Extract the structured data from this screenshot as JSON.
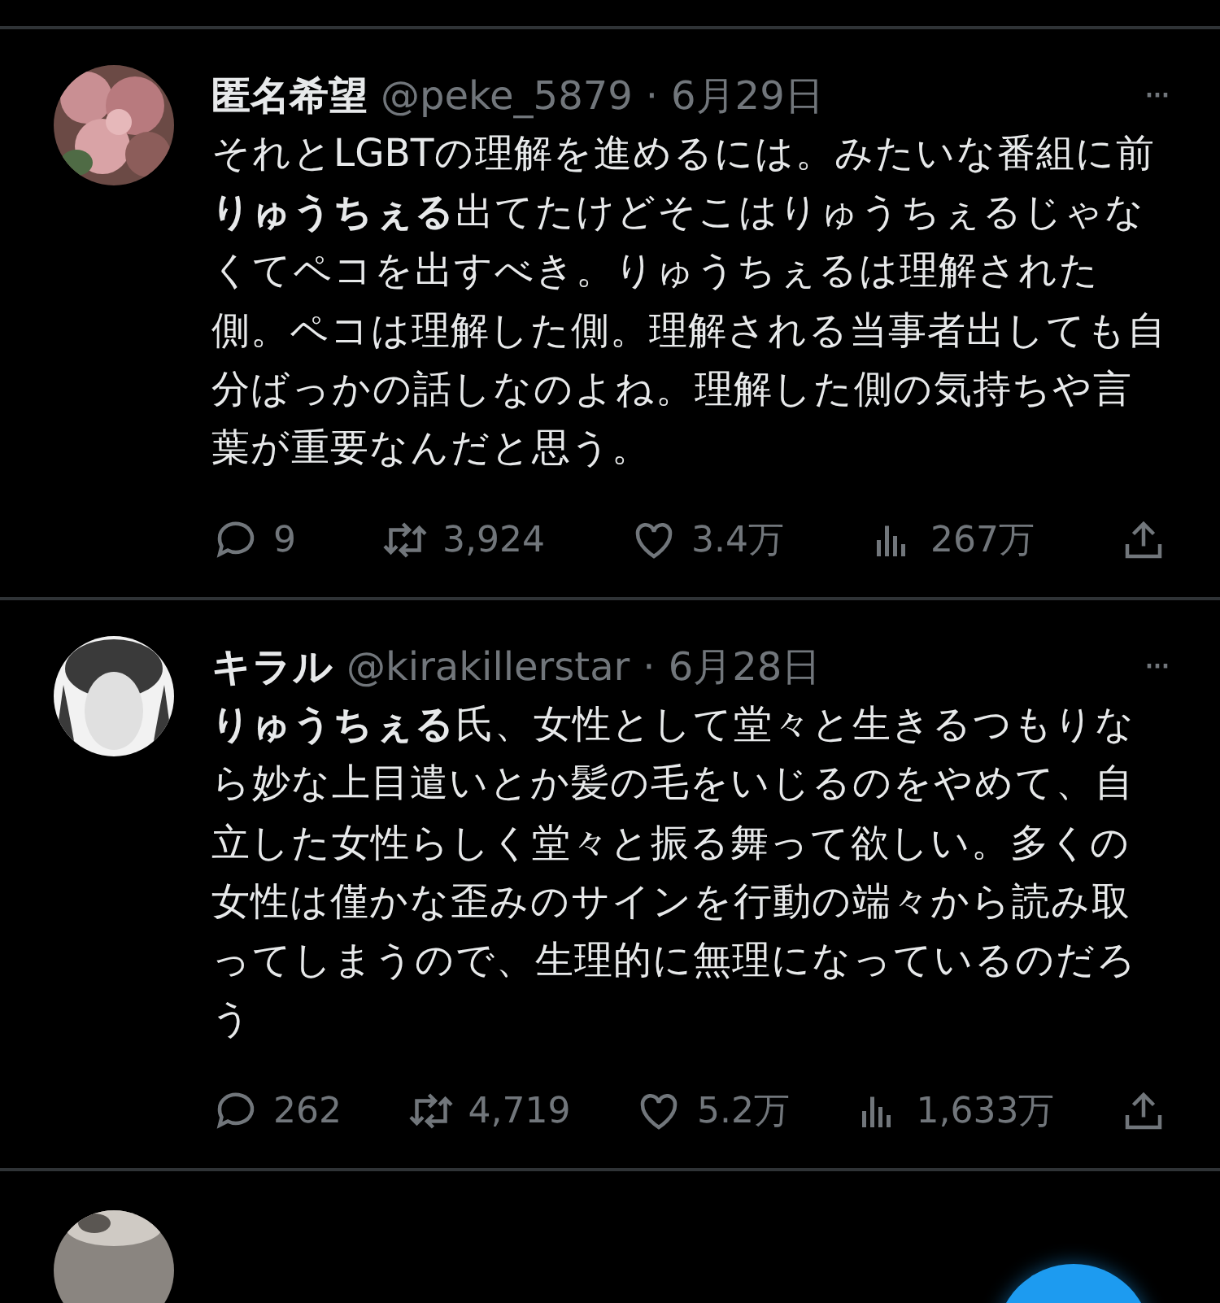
{
  "tweets": [
    {
      "name": "匿名希望",
      "handle": "@peke_5879",
      "separator": "·",
      "date": "6月29日",
      "more": "···",
      "text": "それとLGBTの理解を進めるには。みたいな番組に前**りゅうちぇる**出てたけどそこはりゅうちぇるじゃなくてペコを出すべき。りゅうちぇるは理解された側。ペコは理解した側。理解される当事者出しても自分ばっかの話しなのよね。理解した側の気持ちや言葉が重要なんだと思う。",
      "stats": {
        "replies": "9",
        "retweets": "3,924",
        "likes": "3.4万",
        "views": "267万"
      }
    },
    {
      "name": "キラル",
      "handle": "@kirakillerstar",
      "separator": "·",
      "date": "6月28日",
      "more": "···",
      "text": "**りゅうちぇる**氏、女性として堂々と生きるつもりなら妙な上目遣いとか髪の毛をいじるのをやめて、自立した女性らしく堂々と振る舞って欲しい。多くの女性は僅かな歪みのサインを行動の端々から読み取ってしまうので、生理的に無理になっているのだろう",
      "stats": {
        "replies": "262",
        "retweets": "4,719",
        "likes": "5.2万",
        "views": "1,633万"
      }
    }
  ]
}
